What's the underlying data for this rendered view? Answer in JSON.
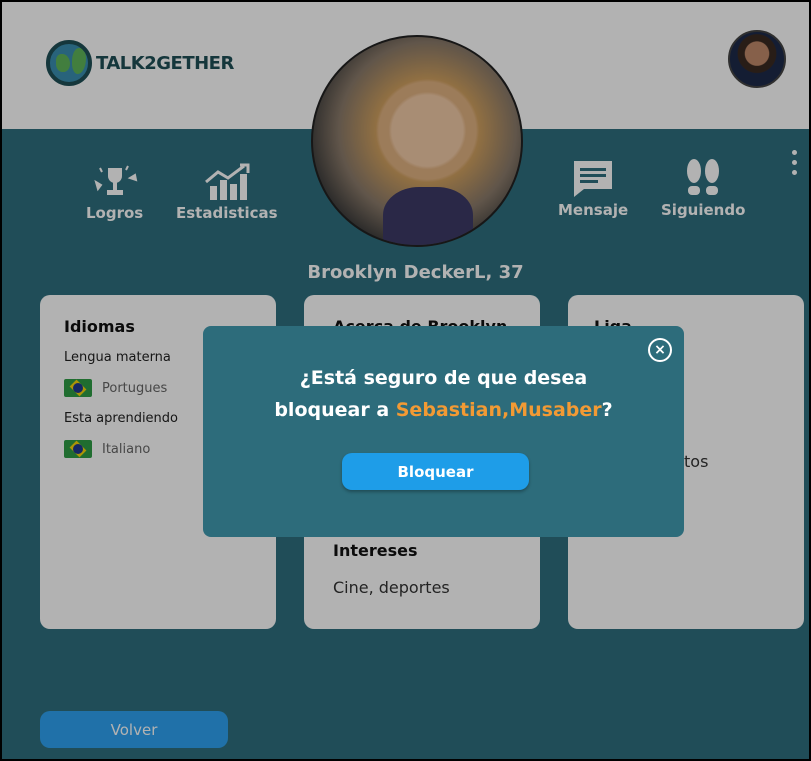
{
  "app": {
    "logo_text": "TALK2GETHER"
  },
  "nav": {
    "logros": "Logros",
    "estadisticas": "Estadisticas",
    "mensaje": "Mensaje",
    "siguiendo": "Siguiendo"
  },
  "profile": {
    "name": "Brooklyn DeckerL, 37"
  },
  "cards": {
    "idiomas": {
      "title": "Idiomas",
      "native_label": "Lengua materna",
      "native_lang": "Portugues",
      "learning_label": "Esta aprendiendo",
      "learning_lang": "Italiano"
    },
    "acerca": {
      "title": "Acerca de Brooklyn",
      "interests_title": "Intereses",
      "interests": "Cine, deportes"
    },
    "liga": {
      "title": "Liga",
      "partial_text": "tos"
    }
  },
  "footer": {
    "back_label": "Volver"
  },
  "modal": {
    "question_line1": "¿Está seguro de que desea",
    "question_prefix": "bloquear a ",
    "target_name": "Sebastian,Musaber",
    "question_suffix": "?",
    "confirm_label": "Bloquear",
    "close_symbol": "×"
  },
  "colors": {
    "background": "#2f6f7e",
    "modal_bg": "#2d6c7b",
    "accent_name": "#f29a34",
    "button": "#1e9de8"
  }
}
